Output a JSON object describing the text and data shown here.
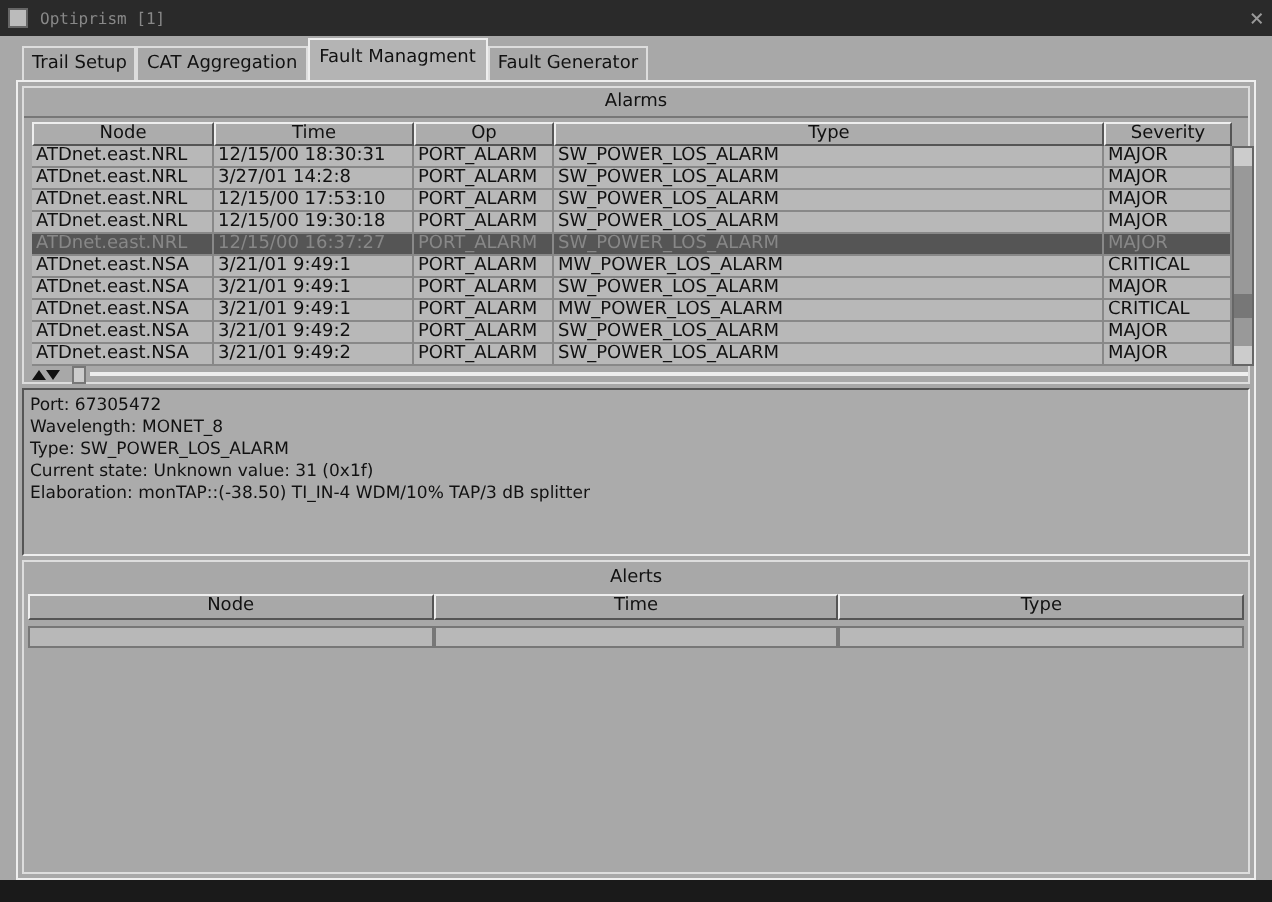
{
  "window": {
    "title": "Optiprism  [1]",
    "close": "×"
  },
  "tabs": [
    {
      "label": "Trail Setup",
      "selected": false
    },
    {
      "label": "CAT Aggregation",
      "selected": false
    },
    {
      "label": "Fault Managment",
      "selected": true
    },
    {
      "label": "Fault Generator",
      "selected": false
    }
  ],
  "alarms": {
    "title": "Alarms",
    "columns": [
      "Node",
      "Time",
      "Op",
      "Type",
      "Severity"
    ],
    "rows": [
      {
        "cells": [
          "ATDnet.east.NRL",
          "12/15/00 18:30:31",
          "PORT_ALARM",
          "SW_POWER_LOS_ALARM",
          "MAJOR"
        ],
        "selected": false
      },
      {
        "cells": [
          "ATDnet.east.NRL",
          "3/27/01 14:2:8",
          "PORT_ALARM",
          "SW_POWER_LOS_ALARM",
          "MAJOR"
        ],
        "selected": false
      },
      {
        "cells": [
          "ATDnet.east.NRL",
          "12/15/00 17:53:10",
          "PORT_ALARM",
          "SW_POWER_LOS_ALARM",
          "MAJOR"
        ],
        "selected": false
      },
      {
        "cells": [
          "ATDnet.east.NRL",
          "12/15/00 19:30:18",
          "PORT_ALARM",
          "SW_POWER_LOS_ALARM",
          "MAJOR"
        ],
        "selected": false
      },
      {
        "cells": [
          "ATDnet.east.NRL",
          "12/15/00 16:37:27",
          "PORT_ALARM",
          "SW_POWER_LOS_ALARM",
          "MAJOR"
        ],
        "selected": true
      },
      {
        "cells": [
          "ATDnet.east.NSA",
          "3/21/01 9:49:1",
          "PORT_ALARM",
          "MW_POWER_LOS_ALARM",
          "CRITICAL"
        ],
        "selected": false
      },
      {
        "cells": [
          "ATDnet.east.NSA",
          "3/21/01 9:49:1",
          "PORT_ALARM",
          "SW_POWER_LOS_ALARM",
          "MAJOR"
        ],
        "selected": false
      },
      {
        "cells": [
          "ATDnet.east.NSA",
          "3/21/01 9:49:1",
          "PORT_ALARM",
          "MW_POWER_LOS_ALARM",
          "CRITICAL"
        ],
        "selected": false
      },
      {
        "cells": [
          "ATDnet.east.NSA",
          "3/21/01 9:49:2",
          "PORT_ALARM",
          "SW_POWER_LOS_ALARM",
          "MAJOR"
        ],
        "selected": false
      },
      {
        "cells": [
          "ATDnet.east.NSA",
          "3/21/01 9:49:2",
          "PORT_ALARM",
          "SW_POWER_LOS_ALARM",
          "MAJOR"
        ],
        "selected": false
      }
    ]
  },
  "details": [
    "Port: 67305472",
    "Wavelength: MONET_8",
    "Type: SW_POWER_LOS_ALARM",
    "Current state: Unknown value: 31 (0x1f)",
    "Elaboration: monTAP::(-38.50) TI_IN-4 WDM/10% TAP/3 dB splitter"
  ],
  "alerts": {
    "title": "Alerts",
    "columns": [
      "Node",
      "Time",
      "Type"
    ]
  }
}
